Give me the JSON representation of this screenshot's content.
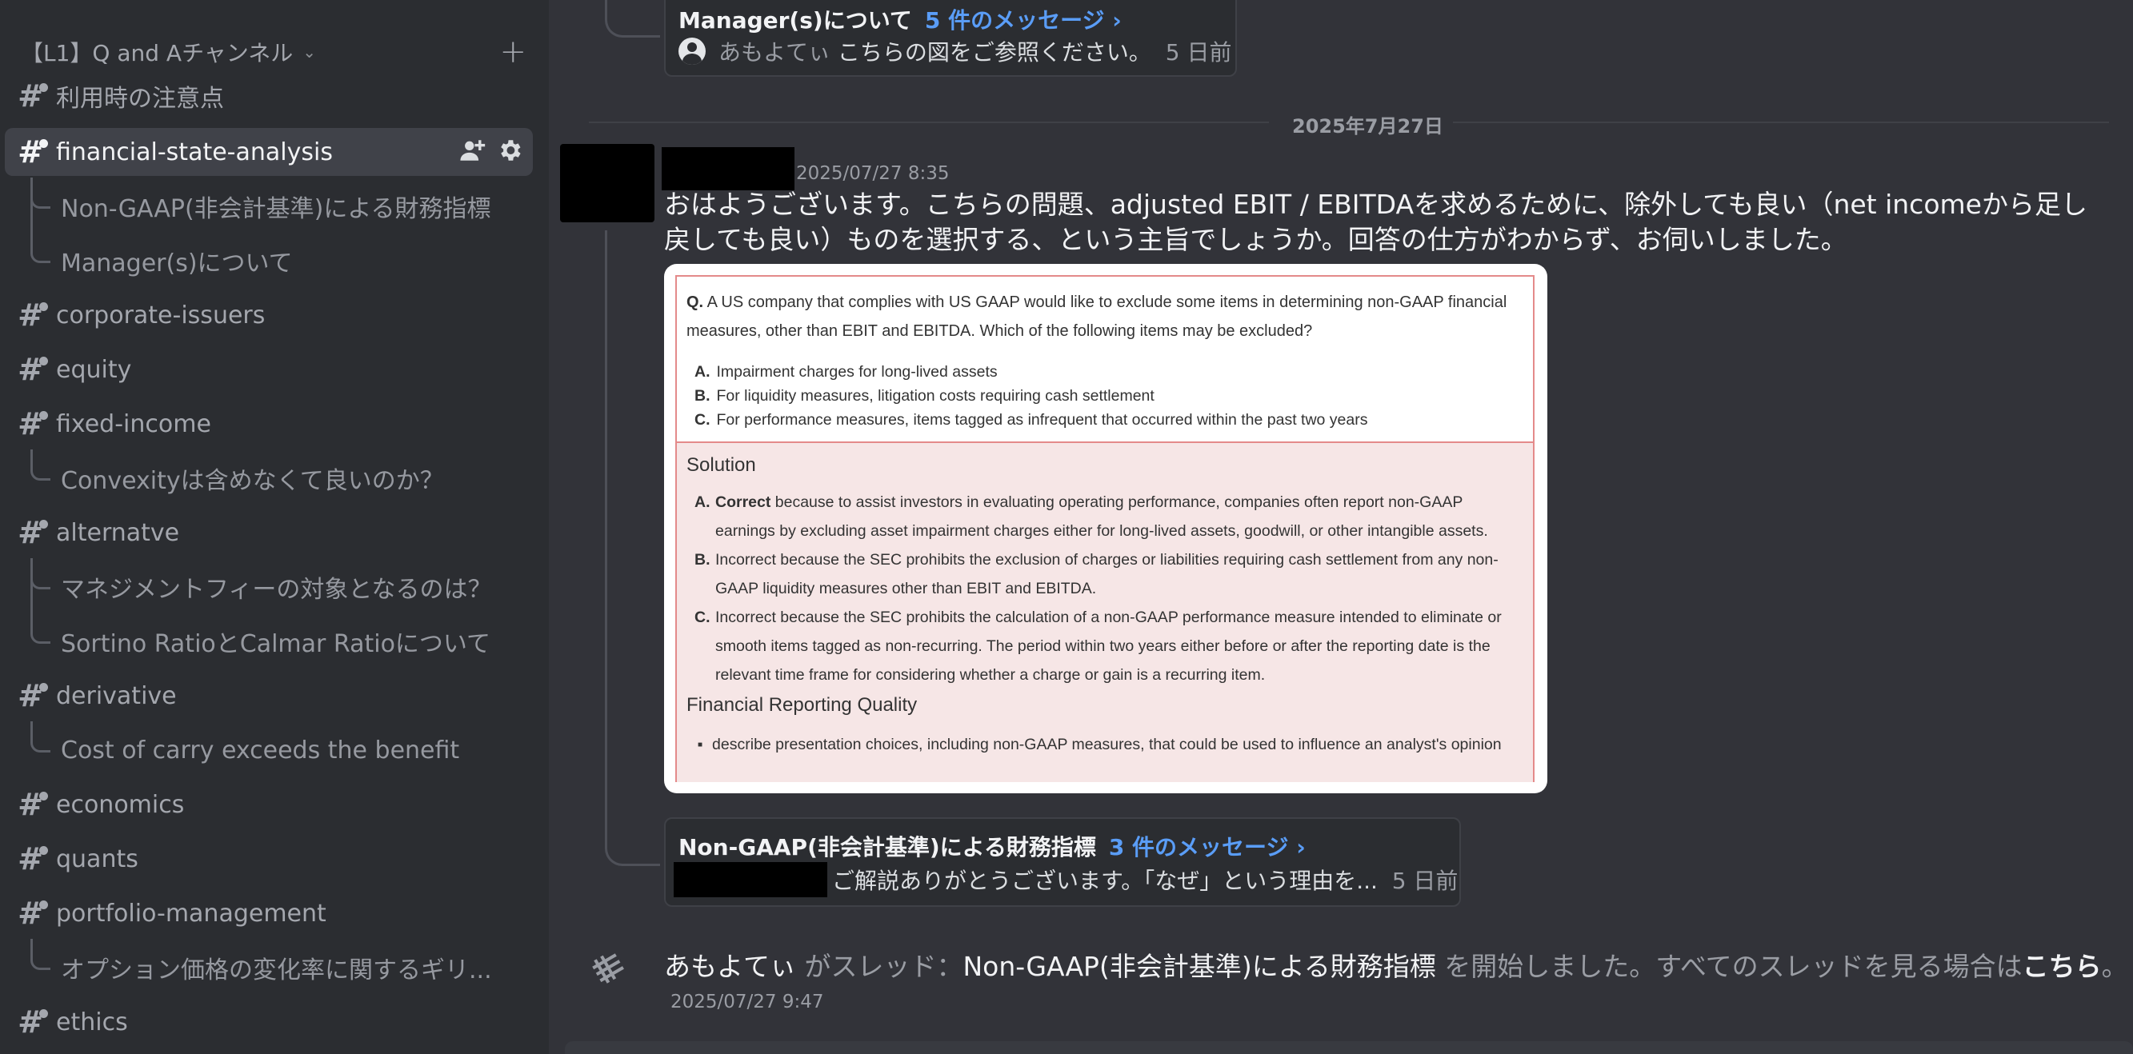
{
  "sidebar": {
    "category": {
      "label": "【L1】Q and Aチャンネル",
      "chevron_icon": "chevron-down-icon",
      "add_icon": "plus-icon"
    },
    "channels": [
      {
        "name": "利用時の注意点",
        "threads": []
      },
      {
        "name": "financial-state-analysis",
        "active": true,
        "threads": [
          "Non-GAAP(非会計基準)による財務指標",
          "Manager(s)について"
        ]
      },
      {
        "name": "corporate-issuers",
        "threads": []
      },
      {
        "name": "equity",
        "threads": []
      },
      {
        "name": "fixed-income",
        "threads": [
          "Convexityは含めなくて良いのか？"
        ]
      },
      {
        "name": "alternatve",
        "threads": [
          "マネジメントフィーの対象となるのは？",
          "Sortino RatioとCalmar Ratioについて"
        ]
      },
      {
        "name": "derivative",
        "threads": [
          "Cost of carry exceeds the benefit"
        ]
      },
      {
        "name": "economics",
        "threads": []
      },
      {
        "name": "quants",
        "threads": []
      },
      {
        "name": "portfolio-management",
        "threads": [
          "オプション価格の変化率に関するギリ..."
        ]
      },
      {
        "name": "ethics",
        "threads": []
      }
    ],
    "active_actions": [
      "create-invite-icon",
      "gear-icon"
    ]
  },
  "chat": {
    "top_thread": {
      "title": "Manager(s)について",
      "count": "5 件のメッセージ ›",
      "author": "あもよてぃ",
      "preview": "こちらの図をご参照ください。",
      "age": "5 日前"
    },
    "date_divider": "2025年7月27日",
    "message": {
      "timestamp": "2025/07/27 8:35",
      "text": "おはようございます。こちらの問題、adjusted EBIT / EBITDAを求めるために、除外しても良い（net incomeから足し戻しても良い）ものを選択する、という主旨でしょうか。回答の仕方がわからず、お伺いしました。"
    },
    "embed": {
      "q_label": "Q.",
      "question": "A US company that complies with US GAAP would like to exclude some items in determining non-GAAP financial measures, other than EBIT and EBITDA. Which of the following items may be excluded?",
      "options": [
        {
          "letter": "A.",
          "text": "Impairment charges for long-lived assets"
        },
        {
          "letter": "B.",
          "text": "For liquidity measures, litigation costs requiring cash settlement"
        },
        {
          "letter": "C.",
          "text": "For performance measures, items tagged as infrequent that occurred within the past two years"
        }
      ],
      "solution_title": "Solution",
      "solutions": [
        {
          "letter": "A.",
          "bold": "Correct",
          "text": " because to assist investors in evaluating operating performance, companies often report non-GAAP earnings by excluding asset impairment charges either for long-lived assets, goodwill, or other intangible assets."
        },
        {
          "letter": "B.",
          "bold": "",
          "text": "Incorrect because the SEC prohibits the exclusion of charges or liabilities requiring cash settlement from any non-GAAP liquidity measures other than EBIT and EBITDA."
        },
        {
          "letter": "C.",
          "bold": "",
          "text": "Incorrect because the SEC prohibits the calculation of a non-GAAP performance measure intended to eliminate or smooth items tagged as non-recurring. The period within two years either before or after the reporting date is the relevant time frame for considering whether a charge or gain is a recurring item."
        }
      ],
      "section_title": "Financial Reporting Quality",
      "bullet": "describe presentation choices, including non-GAAP measures, that could be used to influence an analyst's opinion"
    },
    "reply_thread": {
      "title": "Non-GAAP(非会計基準)による財務指標",
      "count": "3 件のメッセージ ›",
      "preview": "ご解説ありがとうございます。「なぜ」という理由を...",
      "age": "5 日前"
    },
    "system": {
      "user": "あもよてぃ",
      "started": " がスレッド：",
      "thread_name": "Non-GAAP(非会計基準)による財務指標",
      "suffix": " を開始しました。すべてのスレッドを見る場合は",
      "link": "こちら",
      "period": "。",
      "timestamp": "2025/07/27 9:47"
    }
  }
}
